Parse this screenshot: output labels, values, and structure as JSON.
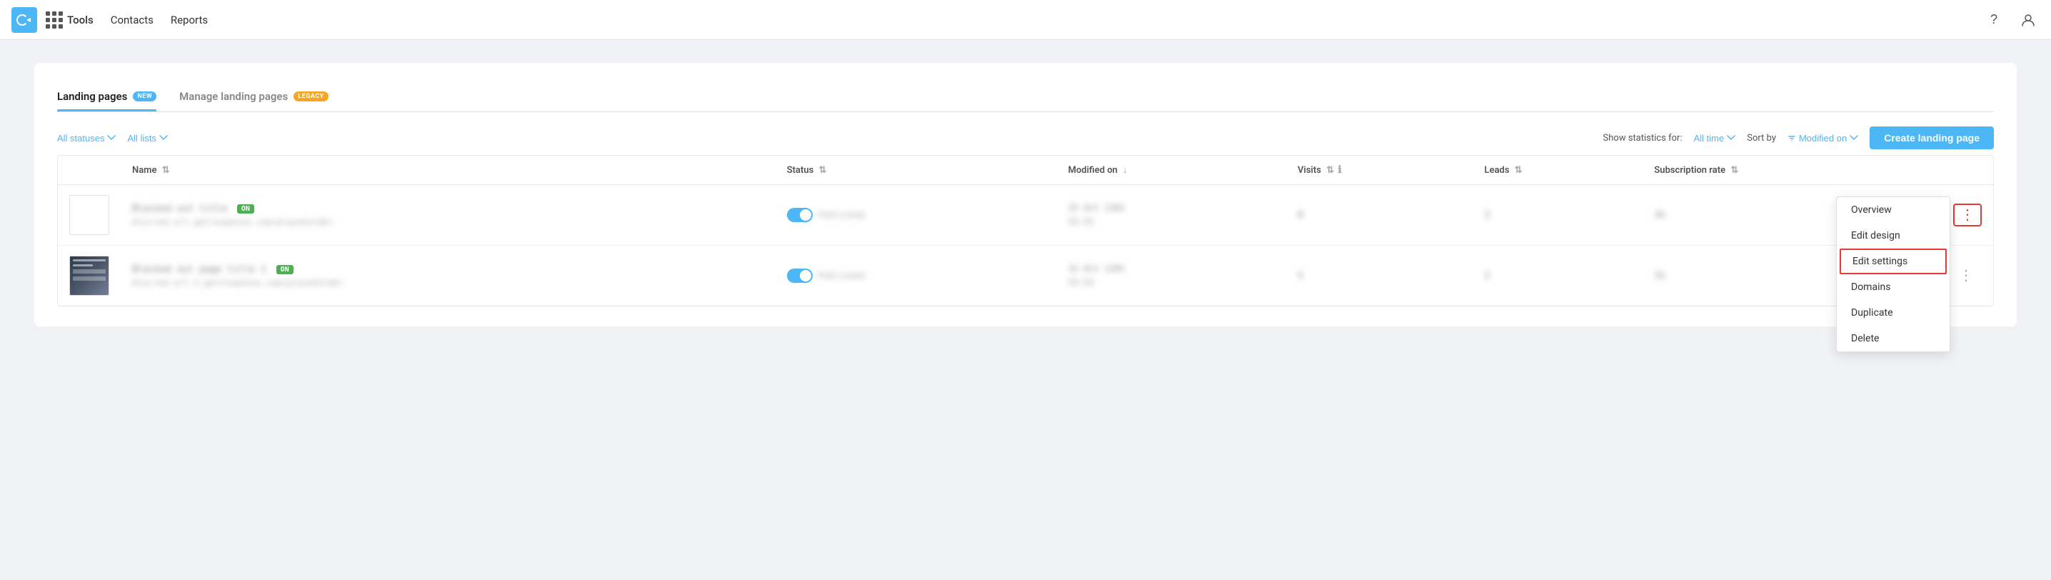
{
  "topnav": {
    "tools_label": "Tools",
    "nav_items": [
      {
        "label": "Contacts",
        "key": "contacts"
      },
      {
        "label": "Reports",
        "key": "reports"
      }
    ],
    "help_icon": "?",
    "user_icon": "👤"
  },
  "tabs": [
    {
      "label": "Landing pages",
      "badge": "NEW",
      "badge_type": "new",
      "active": true
    },
    {
      "label": "Manage landing pages",
      "badge": "LEGACY",
      "badge_type": "legacy",
      "active": false
    }
  ],
  "filters": {
    "status_label": "All statuses",
    "lists_label": "All lists",
    "show_stats_label": "Show statistics for:",
    "show_stats_value": "All time",
    "sort_by_label": "Sort by",
    "sort_by_value": "Modified on",
    "create_btn_label": "Create landing page"
  },
  "table": {
    "columns": [
      {
        "label": "",
        "key": "thumb"
      },
      {
        "label": "Name",
        "key": "name",
        "sortable": true
      },
      {
        "label": "Status",
        "key": "status",
        "sortable": true
      },
      {
        "label": "Modified on",
        "key": "modified",
        "sortable": true
      },
      {
        "label": "Visits",
        "key": "visits",
        "sortable": true
      },
      {
        "label": "Leads",
        "key": "leads",
        "sortable": true
      },
      {
        "label": "Subscription rate",
        "key": "sub_rate",
        "sortable": true
      },
      {
        "label": "",
        "key": "actions"
      }
    ],
    "rows": [
      {
        "id": 1,
        "thumb_type": "blank",
        "name_title": "Blurred name 01",
        "name_subtitle": "blurred-url-placeholder.getresponse.com",
        "name_tag": "ON",
        "status_on": true,
        "status_text": "Published",
        "modified_date": "15 Oct 1201",
        "modified_time": "11:11",
        "visits": "8",
        "leads": "3",
        "sub_rate": "3%",
        "has_menu": true,
        "menu_active": true
      },
      {
        "id": 2,
        "thumb_type": "preview",
        "name_title": "Blurred name 02",
        "name_subtitle": "blurred-url-placeholder-2.getresponse.com",
        "name_tag": "ON",
        "status_on": true,
        "status_text": "Published",
        "modified_date": "15 Oct 1201",
        "modified_time": "11:11",
        "visits": "5",
        "leads": "2",
        "sub_rate": "1%",
        "has_menu": true,
        "menu_active": false
      }
    ]
  },
  "context_menu": {
    "items": [
      {
        "label": "Overview",
        "highlighted": false
      },
      {
        "label": "Edit design",
        "highlighted": false
      },
      {
        "label": "Edit settings",
        "highlighted": true
      },
      {
        "label": "Domains",
        "highlighted": false
      },
      {
        "label": "Duplicate",
        "highlighted": false
      },
      {
        "label": "Delete",
        "highlighted": false
      }
    ]
  }
}
